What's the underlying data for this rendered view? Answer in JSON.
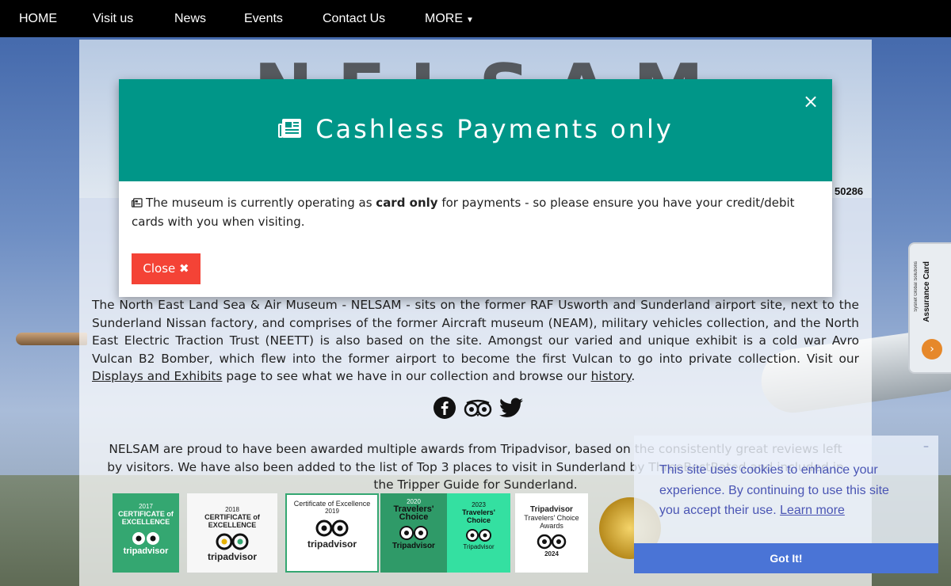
{
  "nav": {
    "items": [
      "HOME",
      "Visit us",
      "News",
      "Events",
      "Contact Us",
      "MORE"
    ]
  },
  "header": {
    "logo_text": "NELSAM",
    "serial": "50286"
  },
  "intro": {
    "text_before": "The North East Land Sea & Air Museum - NELSAM - sits on the former RAF Usworth and Sunderland airport site, next to the Sunderland Nissan factory, and comprises of the former Aircraft museum (NEAM), military vehicles collection, and the North East Electric Traction Trust (NEETT) is also based on the site. Amongst our varied and unique exhibit is a cold war Avro Vulcan B2 Bomber, which flew into the former airport to become the first Vulcan to go into private collection. Visit our ",
    "link_displays": "Displays and Exhibits",
    "text_middle": " page to see what we have in our collection and browse our ",
    "link_history": "history",
    "text_after": "."
  },
  "social": {
    "icons": [
      "facebook-icon",
      "tripadvisor-icon",
      "twitter-icon"
    ]
  },
  "awards": {
    "text": "NELSAM are proud to have been awarded multiple awards from Tripadvisor, based on the consistently great reviews left by visitors. We have also been added to the list of Top 3 places to visit in Sunderland by ThreeBestRated and included in the Tripper Guide for Sunderland.",
    "badges": [
      {
        "year": "2017",
        "line1": "CERTIFICATE of",
        "line2": "EXCELLENCE",
        "brand": "tripadvisor"
      },
      {
        "year": "2018",
        "line1": "CERTIFICATE of",
        "line2": "EXCELLENCE",
        "brand": "tripadvisor"
      },
      {
        "year": "2019",
        "line1": "Certificate of Excellence",
        "line2": "",
        "brand": "tripadvisor"
      },
      {
        "year": "2020",
        "line1": "Travelers'",
        "line2": "Choice",
        "brand": "Tripadvisor"
      },
      {
        "year": "2023",
        "line1": "Travelers'",
        "line2": "Choice",
        "brand": "Tripadvisor"
      },
      {
        "year": "2024",
        "line1": "Tripadvisor",
        "line2": "Travelers' Choice Awards",
        "brand": ""
      }
    ]
  },
  "side_tab": {
    "title": "Assurance Card",
    "subtitle": "Sysnet Global Solutions"
  },
  "modal": {
    "title": "Cashless Payments only",
    "body_before": "The museum is currently operating as ",
    "body_bold": "card only",
    "body_after": " for payments - so please ensure you have your credit/debit cards with you when visiting.",
    "close_label": "Close ✖",
    "close_x": "×"
  },
  "cookie": {
    "text": "This site uses cookies to enhance your experience. By continuing to use this site you accept their use. ",
    "learn_more": "Learn more",
    "button": "Got It!"
  },
  "colors": {
    "modal_header": "#009688",
    "close_button": "#f44336",
    "cookie_text": "#4a55b4",
    "cookie_button": "#4a74d6",
    "nav_bg": "#000000"
  }
}
